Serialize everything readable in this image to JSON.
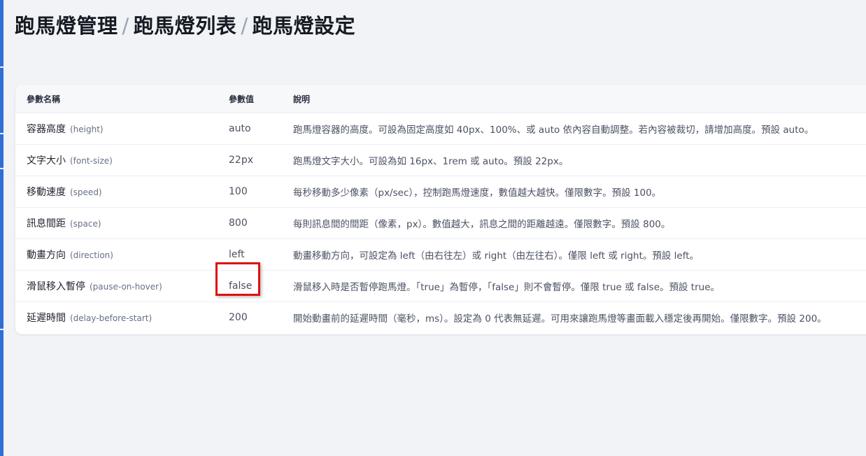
{
  "breadcrumb": {
    "items": [
      "跑馬燈管理",
      "跑馬燈列表",
      "跑馬燈設定"
    ],
    "separator": "/"
  },
  "table": {
    "headers": [
      "參數名稱",
      "參數值",
      "說明"
    ],
    "rows": [
      {
        "name": "容器高度",
        "key": "(height)",
        "value": "auto",
        "desc": "跑馬燈容器的高度。可設為固定高度如 40px、100%、或 auto 依內容自動調整。若內容被裁切，請增加高度。預設 auto。"
      },
      {
        "name": "文字大小",
        "key": "(font-size)",
        "value": "22px",
        "desc": "跑馬燈文字大小。可設為如 16px、1rem 或 auto。預設 22px。"
      },
      {
        "name": "移動速度",
        "key": "(speed)",
        "value": "100",
        "desc": "每秒移動多少像素（px/sec），控制跑馬燈速度，數值越大越快。僅限數字。預設 100。"
      },
      {
        "name": "訊息間距",
        "key": "(space)",
        "value": "800",
        "desc": "每則訊息間的間距（像素，px）。數值越大，訊息之間的距離越遠。僅限數字。預設 800。"
      },
      {
        "name": "動畫方向",
        "key": "(direction)",
        "value": "left",
        "desc": "動畫移動方向，可設定為 left（由右往左）或 right（由左往右）。僅限 left 或 right。預設 left。"
      },
      {
        "name": "滑鼠移入暫停",
        "key": "(pause-on-hover)",
        "value": "false",
        "desc": "滑鼠移入時是否暫停跑馬燈。「true」為暫停，「false」則不會暫停。僅限 true 或 false。預設 true。"
      },
      {
        "name": "延遲時間",
        "key": "(delay-before-start)",
        "value": "200",
        "desc": "開始動畫前的延遲時間（毫秒，ms）。設定為 0 代表無延遲。可用來讓跑馬燈等畫面載入穩定後再開始。僅限數字。預設 200。"
      }
    ]
  },
  "colors": {
    "accent": "#2f6fd6",
    "highlight": "#e01010"
  }
}
